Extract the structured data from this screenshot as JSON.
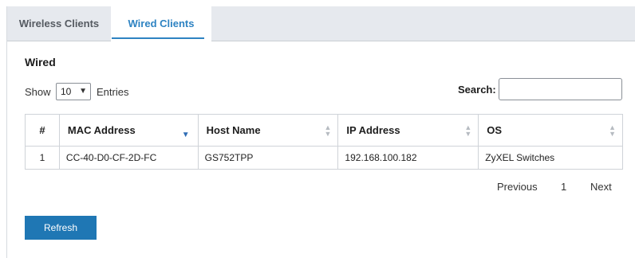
{
  "tabs": [
    {
      "label": "Wireless Clients",
      "active": false
    },
    {
      "label": "Wired Clients",
      "active": true
    }
  ],
  "section": {
    "title": "Wired"
  },
  "length_control": {
    "show_label": "Show",
    "selected": "10",
    "entries_label": "Entries"
  },
  "search": {
    "label": "Search:",
    "value": "",
    "placeholder": ""
  },
  "table": {
    "headers": [
      "#",
      "MAC Address",
      "Host Name",
      "IP Address",
      "OS"
    ],
    "rows": [
      {
        "num": "1",
        "mac": "CC-40-D0-CF-2D-FC",
        "host": "GS752TPP",
        "ip": "192.168.100.182",
        "os": "ZyXEL Switches"
      }
    ]
  },
  "pagination": {
    "previous": "Previous",
    "page": "1",
    "next": "Next"
  },
  "actions": {
    "refresh": "Refresh"
  },
  "colors": {
    "accent": "#2e83c2",
    "button": "#1f77b4",
    "tabbar": "#e6e9ee"
  }
}
